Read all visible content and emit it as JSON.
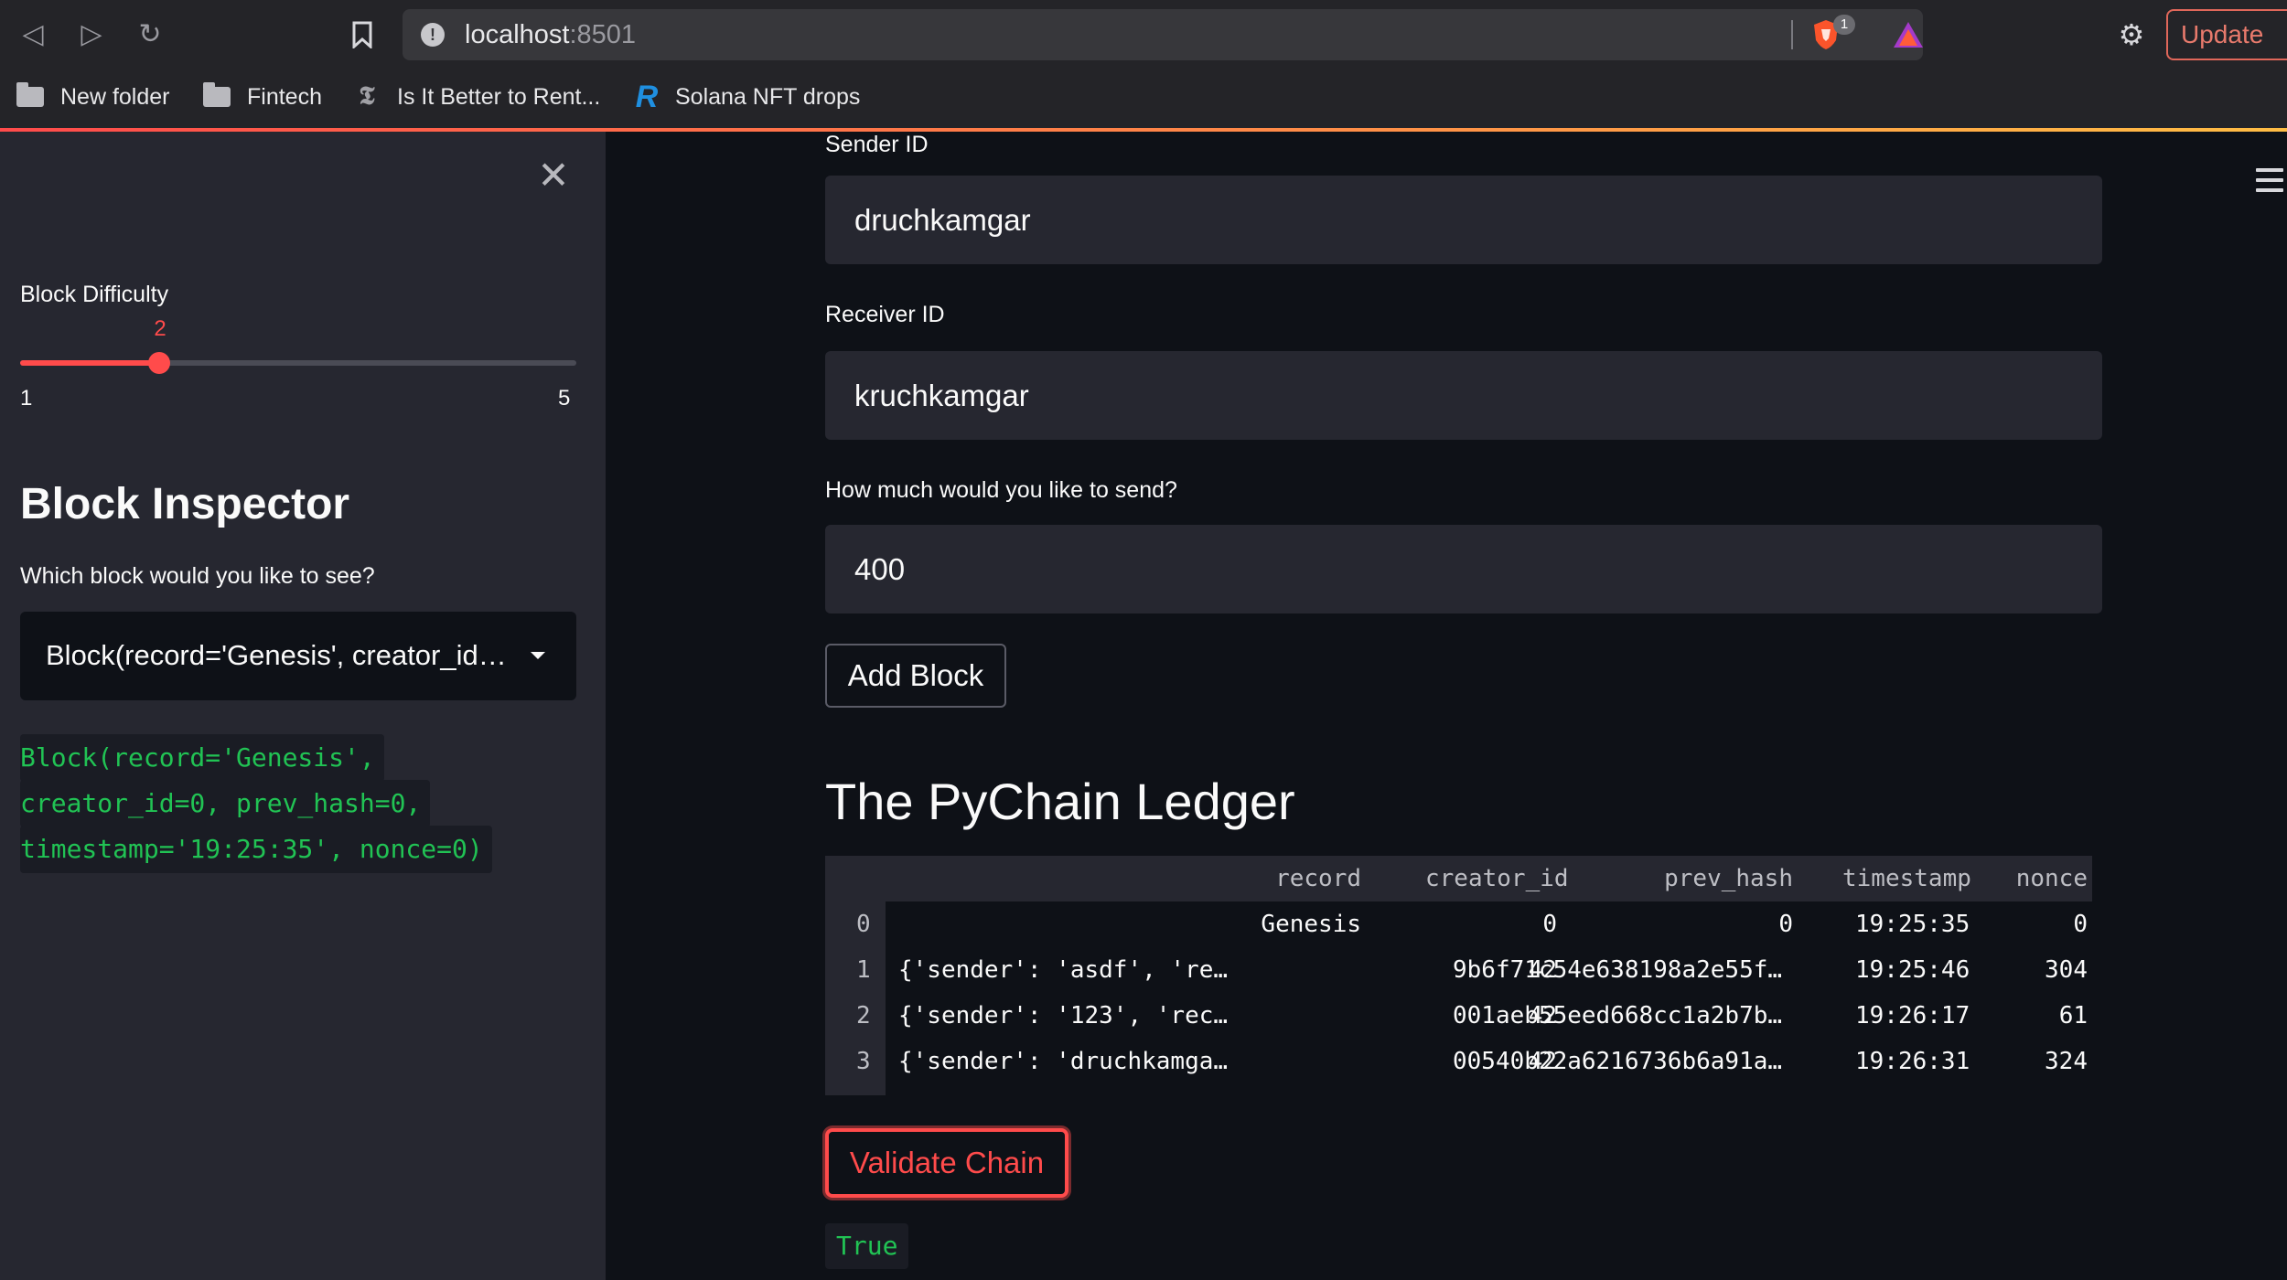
{
  "browser": {
    "url_host": "localhost",
    "url_port": ":8501",
    "shield_count": "1",
    "update_label": "Update",
    "bookmarks": [
      {
        "label": "New folder",
        "icon": "folder-icon"
      },
      {
        "label": "Fintech",
        "icon": "folder-icon"
      },
      {
        "label": "Is It Better to Rent...",
        "icon": "nyt-icon"
      },
      {
        "label": "Solana NFT drops",
        "icon": "r-icon"
      }
    ]
  },
  "sidebar": {
    "difficulty_label": "Block Difficulty",
    "difficulty_value": "2",
    "difficulty_min": "1",
    "difficulty_max": "5",
    "inspector_title": "Block Inspector",
    "select_label": "Which block would you like to see?",
    "select_value": "Block(record='Genesis', creator_id=0, prev_hash=0, timestamp='19:25:35', nonce=0)",
    "block_output": [
      "Block(record='Genesis',",
      "creator_id=0, prev_hash=0,",
      "timestamp='19:25:35', nonce=0)"
    ]
  },
  "form": {
    "sender_label": "Sender ID",
    "sender_value": "druchkamgar",
    "receiver_label": "Receiver ID",
    "receiver_value": "kruchkamgar",
    "amount_label": "How much would you like to send?",
    "amount_value": "400",
    "add_button": "Add Block"
  },
  "ledger": {
    "title": "The PyChain Ledger",
    "columns": [
      "record",
      "creator_id",
      "prev_hash",
      "timestamp",
      "nonce"
    ],
    "rows": [
      {
        "index": "0",
        "record": "Genesis",
        "creator_id": "0",
        "prev_hash": "0",
        "timestamp": "19:25:35",
        "nonce": "0"
      },
      {
        "index": "1",
        "record": "{'sender': 'asdf', 're…",
        "creator_id": "42",
        "prev_hash": "9b6f71c54e638198a2e55f…",
        "timestamp": "19:25:46",
        "nonce": "304"
      },
      {
        "index": "2",
        "record": "{'sender': '123', 'rec…",
        "creator_id": "42",
        "prev_hash": "001aeb55eed668cc1a2b7b…",
        "timestamp": "19:26:17",
        "nonce": "61"
      },
      {
        "index": "3",
        "record": "{'sender': 'druchkamga…",
        "creator_id": "42",
        "prev_hash": "00540b22a6216736b6a91a…",
        "timestamp": "19:26:31",
        "nonce": "324"
      }
    ]
  },
  "validate": {
    "button": "Validate Chain",
    "result": "True"
  },
  "colors": {
    "accent": "#ff4b4b",
    "code_green": "#21c354",
    "sidebar_bg": "#262730",
    "main_bg": "#0e1117"
  }
}
